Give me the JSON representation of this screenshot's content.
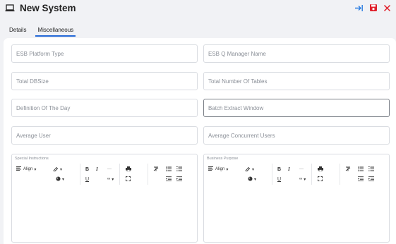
{
  "window": {
    "title": "New System",
    "title_icon": "laptop-icon",
    "actions": [
      {
        "name": "export-icon",
        "color": "#2a7de1"
      },
      {
        "name": "save-icon",
        "color": "#e0202b"
      },
      {
        "name": "close-icon",
        "color": "#e0202b"
      }
    ]
  },
  "tabs": [
    {
      "label": "Details",
      "active": false
    },
    {
      "label": "Miscellaneous",
      "active": true
    }
  ],
  "fields": {
    "esb_platform_type": {
      "placeholder": "ESB Platform Type",
      "value": ""
    },
    "esb_q_manager_name": {
      "placeholder": "ESB Q Manager Name",
      "value": ""
    },
    "total_dbsize": {
      "placeholder": "Total DBSize",
      "value": ""
    },
    "total_number_of_tables": {
      "placeholder": "Total Number Of Tables",
      "value": ""
    },
    "definition_of_the_day": {
      "placeholder": "Definition Of The Day",
      "value": ""
    },
    "batch_extract_window": {
      "placeholder": "Batch Extract Window",
      "value": ""
    },
    "average_user": {
      "placeholder": "Average User",
      "value": ""
    },
    "average_concurrent_users": {
      "placeholder": "Average Concurrent Users",
      "value": ""
    }
  },
  "editors": {
    "special_instructions": {
      "label": "Special Instructions"
    },
    "business_purpose": {
      "label": "Business Purpose"
    }
  },
  "toolbar": {
    "align_label": "Align",
    "bold": "B",
    "italic": "I",
    "underline": "U",
    "hr": "—",
    "link": "∞",
    "dropdown": "▾"
  },
  "colors": {
    "accent": "#2468d6",
    "save": "#e0202b",
    "close": "#e0202b",
    "export": "#2a7de1"
  }
}
